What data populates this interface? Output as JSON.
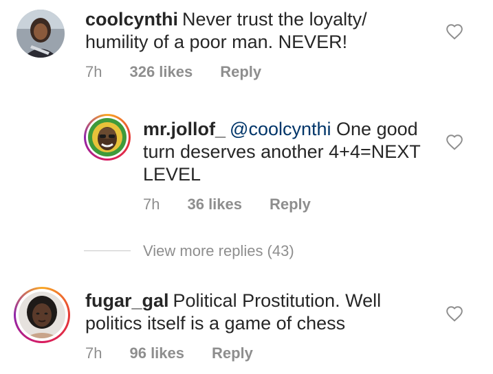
{
  "comments": [
    {
      "username": "coolcynthi",
      "text": "Never trust the loyalty/",
      "text2": "humility of a poor man. NEVER!",
      "time": "7h",
      "likes": "326 likes",
      "reply": "Reply",
      "avatar_icon": "user-photo-avatar"
    },
    {
      "username": "mr.jollof_",
      "mention": "@coolcynthi",
      "text": "One good",
      "text2": "turn deserves another 4+4=NEXT",
      "text3": "LEVEL",
      "time": "7h",
      "likes": "36 likes",
      "reply": "Reply",
      "avatar_icon": "cartoon-face-avatar"
    },
    {
      "username": "fugar_gal",
      "text": "Political Prostitution. Well",
      "text2": "politics itself is a game of chess",
      "time": "7h",
      "likes": "96 likes",
      "reply": "Reply",
      "avatar_icon": "user-photo-avatar"
    }
  ],
  "view_more_replies": "View more replies (43)",
  "colors": {
    "text": "#262626",
    "meta": "#8e8e8e",
    "mention": "#003569",
    "story_ring": [
      "#f9a825",
      "#e53935",
      "#d81b60",
      "#8e24aa"
    ]
  }
}
